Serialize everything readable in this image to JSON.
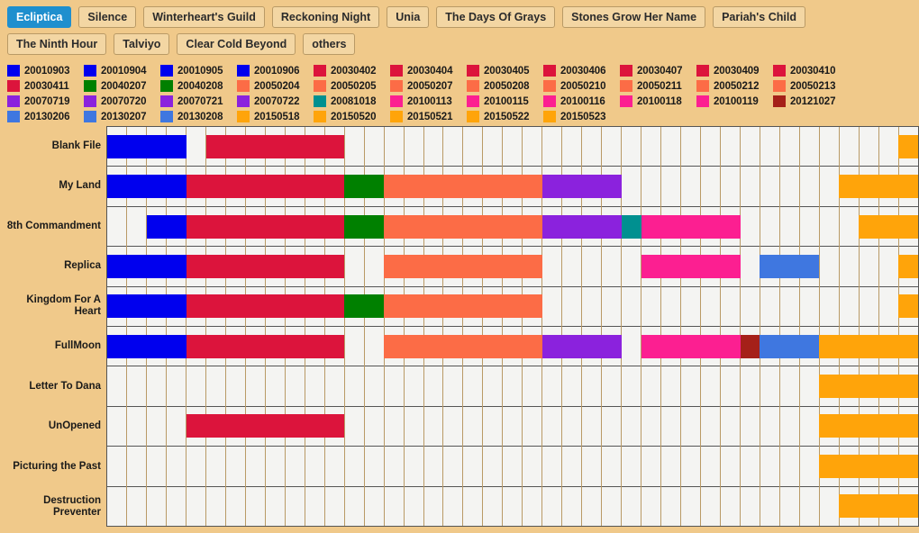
{
  "tabs": [
    {
      "label": "Ecliptica",
      "active": true
    },
    {
      "label": "Silence",
      "active": false
    },
    {
      "label": "Winterheart's Guild",
      "active": false
    },
    {
      "label": "Reckoning Night",
      "active": false
    },
    {
      "label": "Unia",
      "active": false
    },
    {
      "label": "The Days Of Grays",
      "active": false
    },
    {
      "label": "Stones Grow Her Name",
      "active": false
    },
    {
      "label": "Pariah's Child",
      "active": false
    },
    {
      "label": "The Ninth Hour",
      "active": false
    },
    {
      "label": "Talviyo",
      "active": false
    },
    {
      "label": "Clear Cold Beyond",
      "active": false
    },
    {
      "label": "others",
      "active": false
    }
  ],
  "colors": {
    "blue": "#0000ee",
    "crimson": "#dc143c",
    "green": "#008000",
    "salmon": "#fc6c46",
    "purple": "#8b22dd",
    "teal": "#009090",
    "magenta": "#fc1f91",
    "darkred": "#a52019",
    "cornflower": "#3f77e0",
    "orange": "#ffa40a",
    "background": "#f0c98a",
    "plot_background": "#f4f4f2",
    "accent": "#1f8fce",
    "gridline": "#b99a66",
    "rowline": "#555555"
  },
  "legend": [
    {
      "label": "20010903",
      "color": "blue"
    },
    {
      "label": "20010904",
      "color": "blue"
    },
    {
      "label": "20010905",
      "color": "blue"
    },
    {
      "label": "20010906",
      "color": "blue"
    },
    {
      "label": "20030402",
      "color": "crimson"
    },
    {
      "label": "20030404",
      "color": "crimson"
    },
    {
      "label": "20030405",
      "color": "crimson"
    },
    {
      "label": "20030406",
      "color": "crimson"
    },
    {
      "label": "20030407",
      "color": "crimson"
    },
    {
      "label": "20030409",
      "color": "crimson"
    },
    {
      "label": "20030410",
      "color": "crimson"
    },
    {
      "label": "20030411",
      "color": "crimson"
    },
    {
      "label": "20040207",
      "color": "green"
    },
    {
      "label": "20040208",
      "color": "green"
    },
    {
      "label": "20050204",
      "color": "salmon"
    },
    {
      "label": "20050205",
      "color": "salmon"
    },
    {
      "label": "20050207",
      "color": "salmon"
    },
    {
      "label": "20050208",
      "color": "salmon"
    },
    {
      "label": "20050210",
      "color": "salmon"
    },
    {
      "label": "20050211",
      "color": "salmon"
    },
    {
      "label": "20050212",
      "color": "salmon"
    },
    {
      "label": "20050213",
      "color": "salmon"
    },
    {
      "label": "20070719",
      "color": "purple"
    },
    {
      "label": "20070720",
      "color": "purple"
    },
    {
      "label": "20070721",
      "color": "purple"
    },
    {
      "label": "20070722",
      "color": "purple"
    },
    {
      "label": "20081018",
      "color": "teal"
    },
    {
      "label": "20100113",
      "color": "magenta"
    },
    {
      "label": "20100115",
      "color": "magenta"
    },
    {
      "label": "20100116",
      "color": "magenta"
    },
    {
      "label": "20100118",
      "color": "magenta"
    },
    {
      "label": "20100119",
      "color": "magenta"
    },
    {
      "label": "20121027",
      "color": "darkred"
    },
    {
      "label": "20130206",
      "color": "cornflower"
    },
    {
      "label": "20130207",
      "color": "cornflower"
    },
    {
      "label": "20130208",
      "color": "cornflower"
    },
    {
      "label": "20150518",
      "color": "orange"
    },
    {
      "label": "20150520",
      "color": "orange"
    },
    {
      "label": "20150521",
      "color": "orange"
    },
    {
      "label": "20150522",
      "color": "orange"
    },
    {
      "label": "20150523",
      "color": "orange"
    }
  ],
  "chart_data": {
    "type": "heatmap",
    "title": "",
    "xlabel": "",
    "ylabel": "",
    "grid": true,
    "legend_position": "top",
    "columns": [
      "20010903",
      "20010904",
      "20010905",
      "20010906",
      "20030402",
      "20030404",
      "20030405",
      "20030406",
      "20030407",
      "20030409",
      "20030410",
      "20030411",
      "20040207",
      "20040208",
      "20050204",
      "20050205",
      "20050207",
      "20050208",
      "20050210",
      "20050211",
      "20050212",
      "20050213",
      "20070719",
      "20070720",
      "20070721",
      "20070722",
      "20081018",
      "20100113",
      "20100115",
      "20100116",
      "20100118",
      "20100119",
      "20121027",
      "20130206",
      "20130207",
      "20130208",
      "20150518",
      "20150520",
      "20150521",
      "20150522",
      "20150523"
    ],
    "rows": [
      {
        "label": "Blank File",
        "cells": [
          1,
          1,
          1,
          1,
          0,
          1,
          1,
          1,
          1,
          1,
          1,
          1,
          0,
          0,
          0,
          0,
          0,
          0,
          0,
          0,
          0,
          0,
          0,
          0,
          0,
          0,
          0,
          0,
          0,
          0,
          0,
          0,
          0,
          0,
          0,
          0,
          0,
          0,
          0,
          0,
          1
        ]
      },
      {
        "label": "My Land",
        "cells": [
          1,
          1,
          1,
          1,
          1,
          1,
          1,
          1,
          1,
          1,
          1,
          1,
          1,
          1,
          1,
          1,
          1,
          1,
          1,
          1,
          1,
          1,
          1,
          1,
          1,
          1,
          0,
          0,
          0,
          0,
          0,
          0,
          0,
          0,
          0,
          0,
          0,
          1,
          1,
          1,
          1
        ]
      },
      {
        "label": "8th Commandment",
        "cells": [
          0,
          0,
          1,
          1,
          1,
          1,
          1,
          1,
          1,
          1,
          1,
          1,
          1,
          1,
          1,
          1,
          1,
          1,
          1,
          1,
          1,
          1,
          1,
          1,
          1,
          1,
          1,
          1,
          1,
          1,
          1,
          1,
          0,
          0,
          0,
          0,
          0,
          0,
          1,
          1,
          1
        ]
      },
      {
        "label": "Replica",
        "cells": [
          1,
          1,
          1,
          1,
          1,
          1,
          1,
          1,
          1,
          1,
          1,
          1,
          0,
          0,
          1,
          1,
          1,
          1,
          1,
          1,
          1,
          1,
          0,
          0,
          0,
          0,
          0,
          1,
          1,
          1,
          1,
          1,
          0,
          1,
          1,
          1,
          0,
          0,
          0,
          0,
          1
        ]
      },
      {
        "label": "Kingdom For A Heart",
        "cells": [
          1,
          1,
          1,
          1,
          1,
          1,
          1,
          1,
          1,
          1,
          1,
          1,
          1,
          1,
          1,
          1,
          1,
          1,
          1,
          1,
          1,
          1,
          0,
          0,
          0,
          0,
          0,
          0,
          0,
          0,
          0,
          0,
          0,
          0,
          0,
          0,
          0,
          0,
          0,
          0,
          1
        ]
      },
      {
        "label": "FullMoon",
        "cells": [
          1,
          1,
          1,
          1,
          1,
          1,
          1,
          1,
          1,
          1,
          1,
          1,
          0,
          0,
          1,
          1,
          1,
          1,
          1,
          1,
          1,
          1,
          1,
          1,
          1,
          1,
          0,
          1,
          1,
          1,
          1,
          1,
          1,
          1,
          1,
          1,
          1,
          1,
          1,
          1,
          1
        ]
      },
      {
        "label": "Letter To Dana",
        "cells": [
          0,
          0,
          0,
          0,
          0,
          0,
          0,
          0,
          0,
          0,
          0,
          0,
          0,
          0,
          0,
          0,
          0,
          0,
          0,
          0,
          0,
          0,
          0,
          0,
          0,
          0,
          0,
          0,
          0,
          0,
          0,
          0,
          0,
          0,
          0,
          0,
          1,
          1,
          1,
          1,
          1
        ]
      },
      {
        "label": "UnOpened",
        "cells": [
          0,
          0,
          0,
          0,
          1,
          1,
          1,
          1,
          1,
          1,
          1,
          1,
          0,
          0,
          0,
          0,
          0,
          0,
          0,
          0,
          0,
          0,
          0,
          0,
          0,
          0,
          0,
          0,
          0,
          0,
          0,
          0,
          0,
          0,
          0,
          0,
          1,
          1,
          1,
          1,
          1
        ]
      },
      {
        "label": "Picturing the Past",
        "cells": [
          0,
          0,
          0,
          0,
          0,
          0,
          0,
          0,
          0,
          0,
          0,
          0,
          0,
          0,
          0,
          0,
          0,
          0,
          0,
          0,
          0,
          0,
          0,
          0,
          0,
          0,
          0,
          0,
          0,
          0,
          0,
          0,
          0,
          0,
          0,
          0,
          1,
          1,
          1,
          1,
          1
        ]
      },
      {
        "label": "Destruction Preventer",
        "cells": [
          0,
          0,
          0,
          0,
          0,
          0,
          0,
          0,
          0,
          0,
          0,
          0,
          0,
          0,
          0,
          0,
          0,
          0,
          0,
          0,
          0,
          0,
          0,
          0,
          0,
          0,
          0,
          0,
          0,
          0,
          0,
          0,
          0,
          0,
          0,
          0,
          0,
          1,
          1,
          1,
          1
        ]
      }
    ]
  }
}
